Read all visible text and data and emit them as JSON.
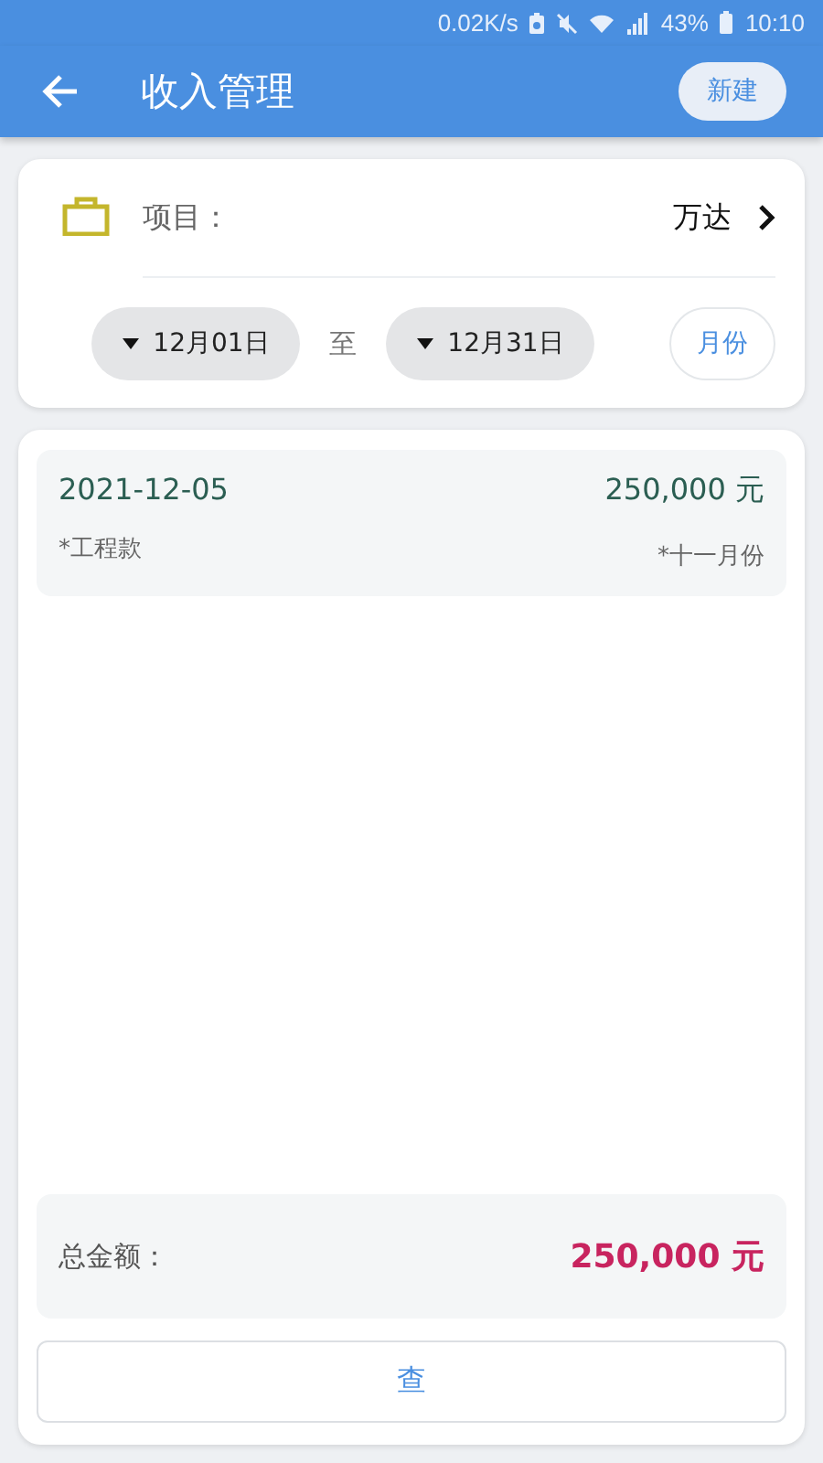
{
  "status_bar": {
    "speed": "0.02K/s",
    "battery": "43%",
    "time": "10:10"
  },
  "app_bar": {
    "title": "收入管理",
    "action": "新建"
  },
  "filter": {
    "project_label": "项目：",
    "project_value": "万达",
    "start_date": "12月01日",
    "separator": "至",
    "end_date": "12月31日",
    "period_button": "月份"
  },
  "records": [
    {
      "date": "2021-12-05",
      "amount": "250,000 元",
      "category": "*工程款",
      "period": "*十一月份"
    }
  ],
  "total": {
    "label": "总金额：",
    "amount": "250,000 元"
  },
  "query_button": "查"
}
